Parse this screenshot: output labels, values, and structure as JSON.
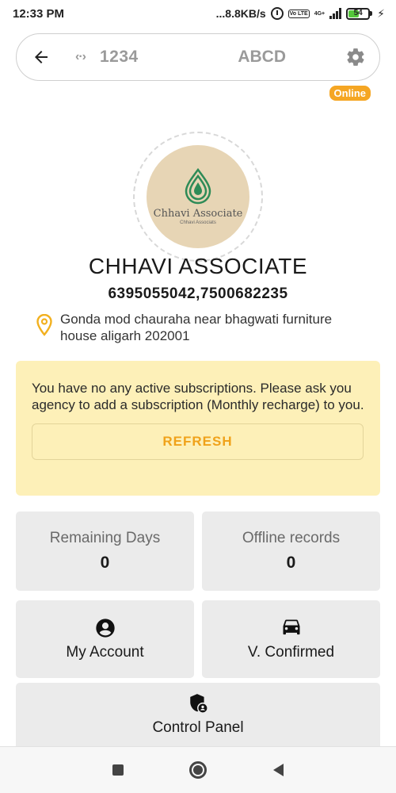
{
  "status_bar": {
    "time": "12:33 PM",
    "network_speed": "...8.8KB/s",
    "volte": "Vo LTE",
    "network_type": "4G+",
    "battery": "54"
  },
  "top_bar": {
    "code": "1234",
    "name": "ABCD"
  },
  "online_badge": "Online",
  "logo": {
    "title": "Chhavi Associate",
    "subtitle": "Chhavi Associats"
  },
  "company": {
    "name": "CHHAVI ASSOCIATE",
    "phone": "6395055042,7500682235",
    "address": "Gonda mod chauraha near bhagwati furniture house aligarh 202001"
  },
  "notice": {
    "message": "You have no any active subscriptions. Please ask you agency to add a subscription (Monthly recharge) to you.",
    "refresh_label": "REFRESH"
  },
  "tiles": {
    "remaining_days": {
      "label": "Remaining Days",
      "value": "0"
    },
    "offline_records": {
      "label": "Offline records",
      "value": "0"
    },
    "my_account": {
      "label": "My Account",
      "icon": "account-circle-icon"
    },
    "v_confirmed": {
      "label": "V. Confirmed",
      "icon": "car-icon"
    },
    "control_panel": {
      "label": "Control Panel",
      "icon": "shield-user-icon"
    }
  },
  "colors": {
    "accent": "#f5a623",
    "notice_bg": "#fdf0b8",
    "tile_bg": "#ebebeb",
    "logo_green": "#2e8b57"
  }
}
